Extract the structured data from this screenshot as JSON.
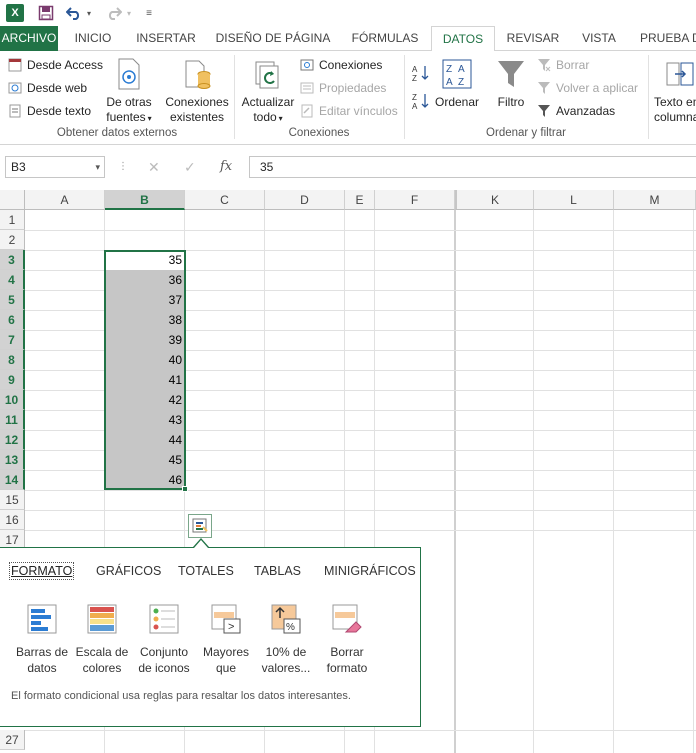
{
  "quick_access": {
    "app_logo": "X",
    "save_icon": "save-icon",
    "undo_icon": "undo-icon",
    "redo_icon": "redo-icon",
    "customize_icon": "customize-icon"
  },
  "tabs": [
    {
      "label": "ARCHIVO"
    },
    {
      "label": "INICIO"
    },
    {
      "label": "INSERTAR"
    },
    {
      "label": "DISEÑO DE PÁGINA"
    },
    {
      "label": "FÓRMULAS"
    },
    {
      "label": "DATOS"
    },
    {
      "label": "REVISAR"
    },
    {
      "label": "VISTA"
    },
    {
      "label": "PRUEBA DE"
    }
  ],
  "ribbon": {
    "external": {
      "access": "Desde Access",
      "web": "Desde web",
      "text": "Desde texto",
      "other_line1": "De otras",
      "other_line2": "fuentes",
      "existing_line1": "Conexiones",
      "existing_line2": "existentes",
      "group_label": "Obtener datos externos"
    },
    "connections": {
      "refresh_line1": "Actualizar",
      "refresh_line2": "todo",
      "connections": "Conexiones",
      "properties": "Propiedades",
      "edit_links": "Editar vínculos",
      "group_label": "Conexiones"
    },
    "sort_filter": {
      "az": "A Z",
      "za": "Z A",
      "sort": "Ordenar",
      "filter": "Filtro",
      "clear": "Borrar",
      "reapply": "Volver a aplicar",
      "advanced": "Avanzadas",
      "group_label": "Ordenar y filtrar"
    },
    "data_tools": {
      "text_columns_line1": "Texto en",
      "text_columns_line2": "columnas"
    }
  },
  "formula_bar": {
    "name_box": "B3",
    "cancel_glyph": "✕",
    "enter_glyph": "✓",
    "fx_label": "fx",
    "formula": "35"
  },
  "sheet": {
    "columns": [
      "A",
      "B",
      "C",
      "D",
      "E",
      "F",
      "K",
      "L",
      "M"
    ],
    "rows": [
      "1",
      "2",
      "3",
      "4",
      "5",
      "6",
      "7",
      "8",
      "9",
      "10",
      "11",
      "12",
      "13",
      "14",
      "15",
      "16",
      "17",
      "27"
    ],
    "active_column": "B",
    "selected_rows": [
      "3",
      "4",
      "5",
      "6",
      "7",
      "8",
      "9",
      "10",
      "11",
      "12",
      "13",
      "14"
    ],
    "column_b_values": [
      "35",
      "36",
      "37",
      "38",
      "39",
      "40",
      "41",
      "42",
      "43",
      "44",
      "45",
      "46"
    ]
  },
  "quick_analysis": {
    "tabs": [
      "FORMATO",
      "GRÁFICOS",
      "TOTALES",
      "TABLAS",
      "MINIGRÁFICOS"
    ],
    "active_tab": "FORMATO",
    "options": [
      {
        "line1": "Barras de",
        "line2": "datos"
      },
      {
        "line1": "Escala de",
        "line2": "colores"
      },
      {
        "line1": "Conjunto",
        "line2": "de iconos"
      },
      {
        "line1": "Mayores",
        "line2": "que"
      },
      {
        "line1": "10% de",
        "line2": "valores..."
      },
      {
        "line1": "Borrar",
        "line2": "formato"
      }
    ],
    "description": "El formato condicional usa reglas para resaltar los datos interesantes."
  },
  "colors": {
    "excel_green": "#217346",
    "selection_fill": "#c6c6c6",
    "header_bg": "#f3f3f3"
  }
}
